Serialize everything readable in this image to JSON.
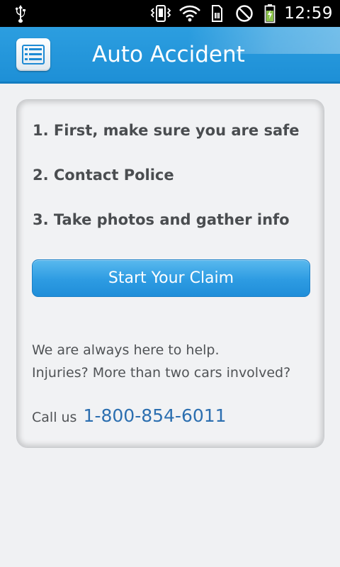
{
  "status_bar": {
    "time": "12:59",
    "icons": [
      "usb-icon",
      "vibrate-icon",
      "wifi-icon",
      "sim-card-icon",
      "blocked-icon",
      "battery-charging-icon"
    ]
  },
  "header": {
    "title": "Auto Accident",
    "menu_icon": "list-menu-icon"
  },
  "steps": [
    "1. First, make sure you are safe",
    "2. Contact Police",
    "3. Take photos and gather info"
  ],
  "claim_button": {
    "label": "Start Your Claim"
  },
  "help": {
    "line1": "We are always here to help.",
    "line2": "Injuries? More than two cars involved?",
    "call_label": "Call us",
    "phone": "1-800-854-6011"
  },
  "colors": {
    "header_blue": "#1d8fd6",
    "button_blue": "#2d9be2",
    "phone_link": "#2c6fb0",
    "text_gray": "#4a4d50",
    "battery_green": "#8bc34a"
  }
}
